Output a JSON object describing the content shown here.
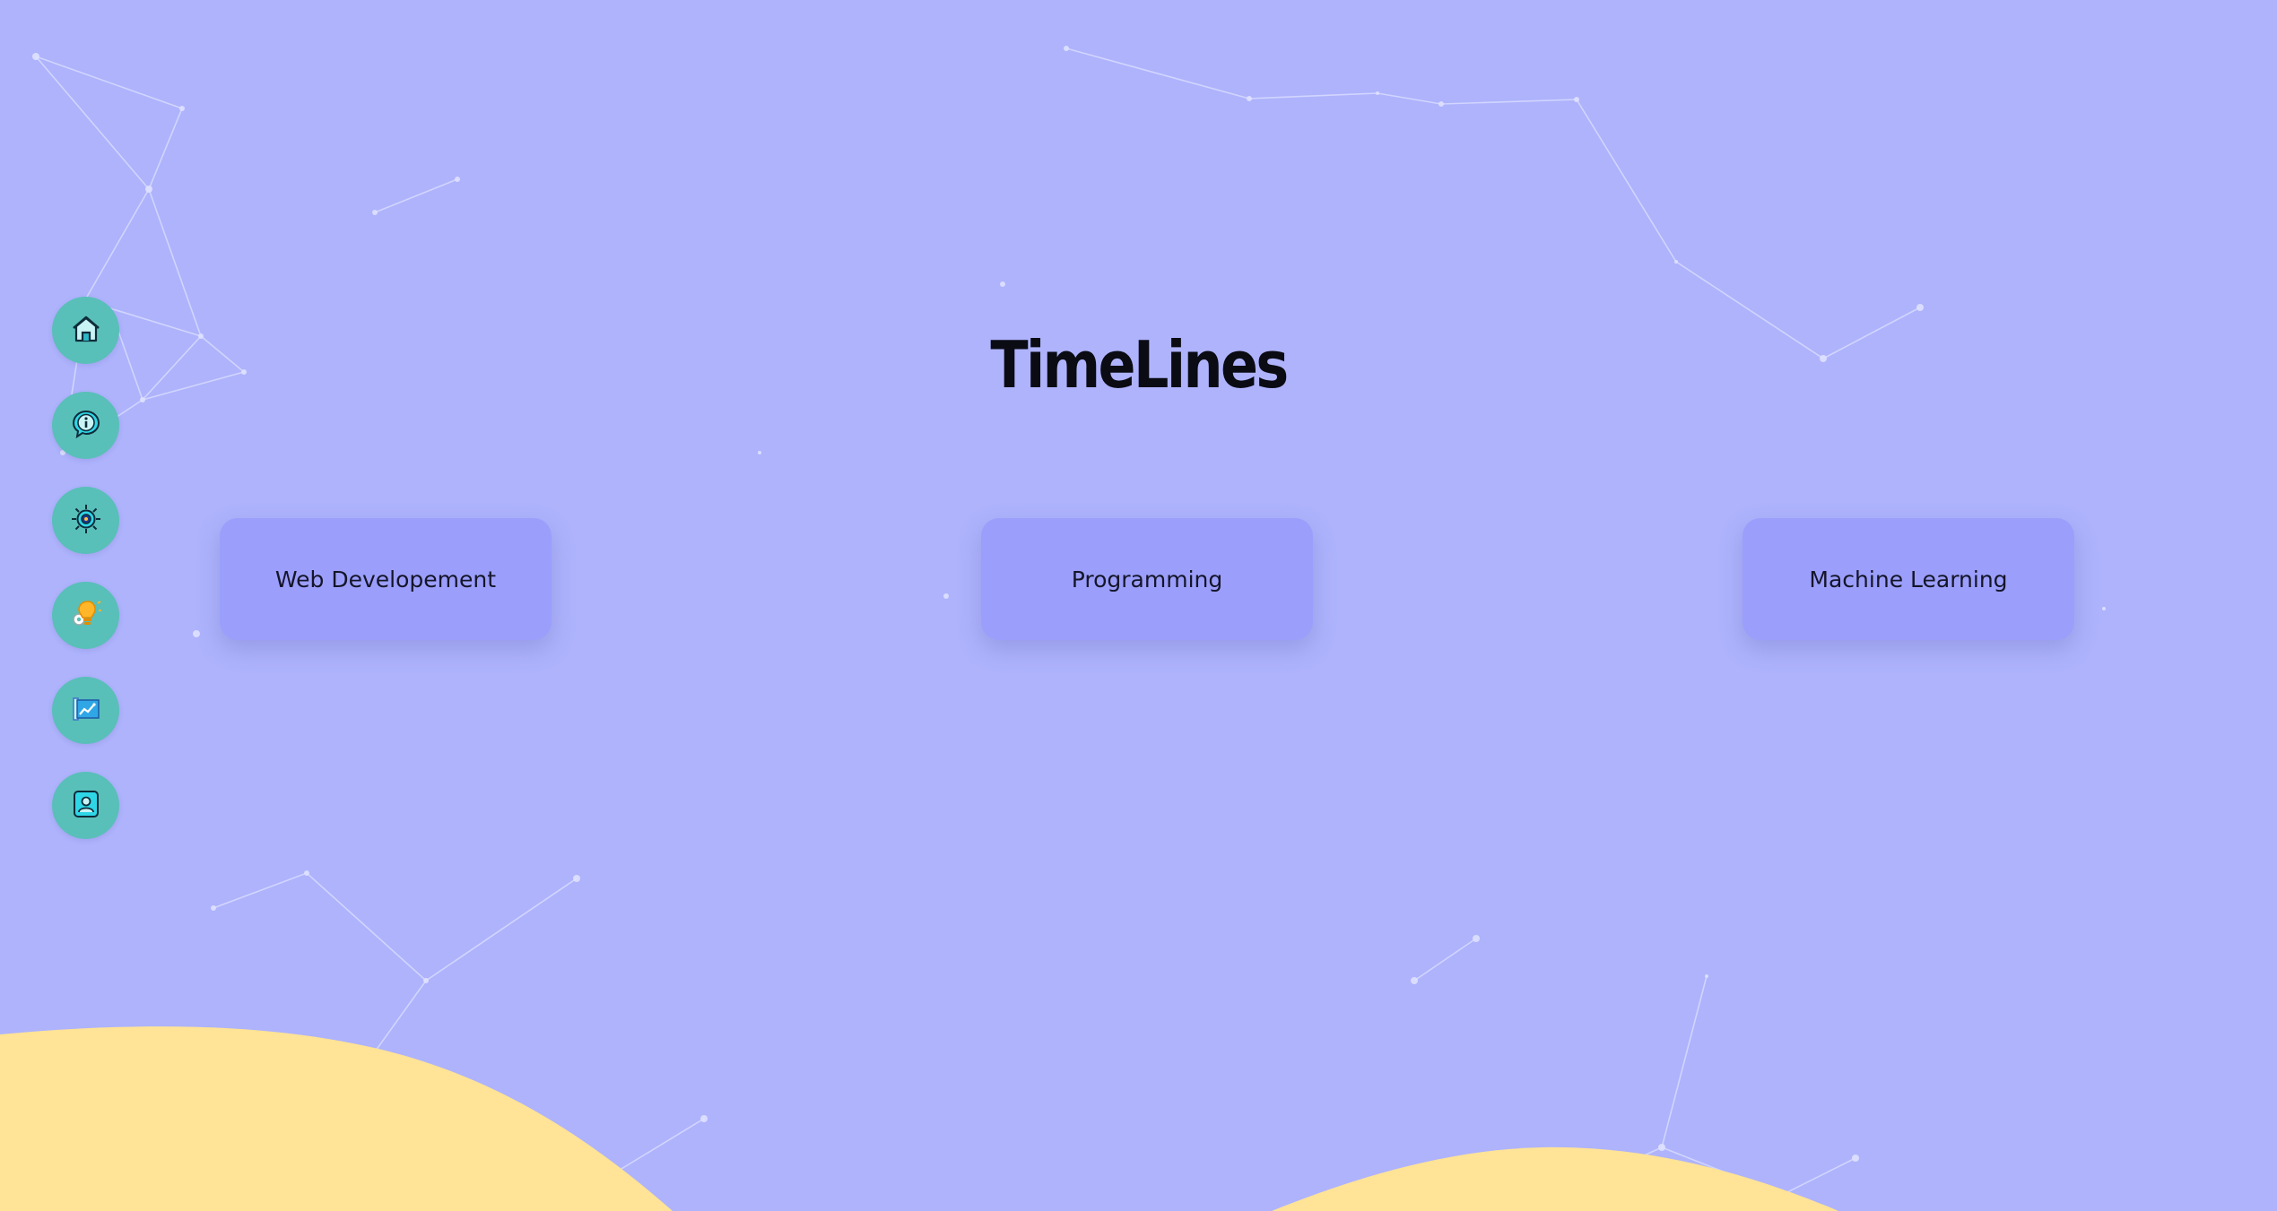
{
  "page": {
    "title": "TimeLines"
  },
  "colors": {
    "background": "#aeb3fc",
    "card": "#9b9ffb",
    "nav_button": "#59bfb9",
    "wave": "#ffe396",
    "network_lines": "#d8dbff"
  },
  "sidebar": {
    "items": [
      {
        "name": "home",
        "icon": "home-icon"
      },
      {
        "name": "about",
        "icon": "info-icon"
      },
      {
        "name": "skills",
        "icon": "gear-icon"
      },
      {
        "name": "ideas",
        "icon": "lightbulb-gear-icon"
      },
      {
        "name": "projects",
        "icon": "chart-icon"
      },
      {
        "name": "contact",
        "icon": "contact-card-icon"
      }
    ]
  },
  "timelines": [
    {
      "label": "Web Developement"
    },
    {
      "label": "Programming"
    },
    {
      "label": "Machine Learning"
    }
  ]
}
